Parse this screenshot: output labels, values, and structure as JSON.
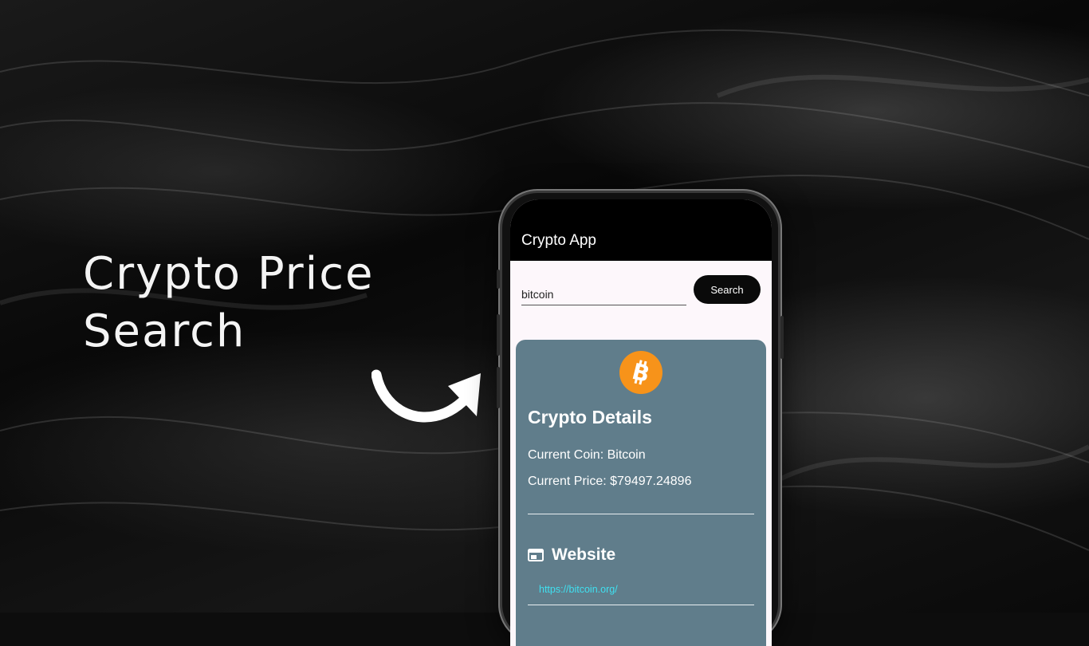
{
  "headline": {
    "line1": "Crypto Price",
    "line2": "Search"
  },
  "app": {
    "title": "Crypto App",
    "search": {
      "value": "bitcoin",
      "button_label": "Search"
    },
    "details": {
      "coin_icon": "bitcoin-icon",
      "title": "Crypto Details",
      "current_coin": "Current Coin: Bitcoin",
      "current_price": "Current Price: $79497.24896",
      "website_icon": "browser-window-icon",
      "website_title": "Website",
      "website_url": "https://bitcoin.org/"
    }
  },
  "colors": {
    "appbar": "#000000",
    "card": "#607d8b",
    "button": "#0a0a0a",
    "coin": "#f7931a",
    "link": "#3fe0f0"
  }
}
